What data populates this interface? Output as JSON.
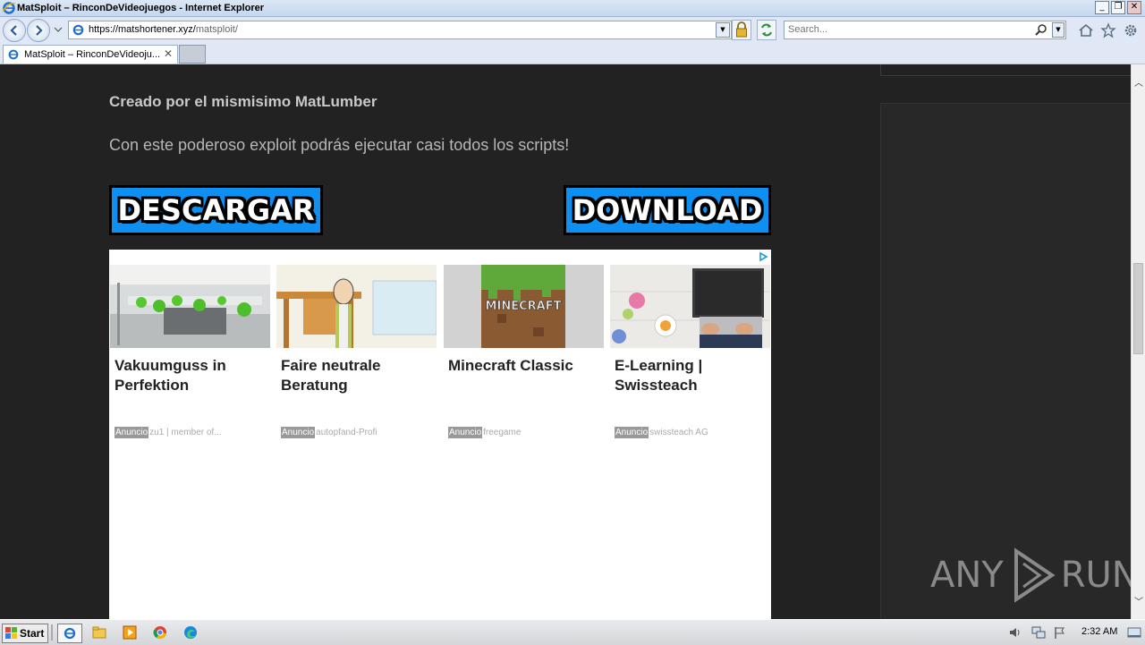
{
  "window": {
    "title": "MatSploit – RinconDeVideojuegos - Internet Explorer",
    "minimize": "_",
    "restore": "❐",
    "close": "✕"
  },
  "address": {
    "url_host": "https://matshortener.xyz/",
    "url_path": "matsploit/"
  },
  "search": {
    "placeholder": "Search..."
  },
  "tab": {
    "label": "MatSploit – RinconDeVideoju...",
    "close": "✕"
  },
  "page": {
    "creator": "Creado por el mismisimo MatLumber",
    "description": "Con este poderoso exploit podrás ejecutar casi todos los scripts!",
    "download_es": "DESCARGAR",
    "download_en": "DOWNLOAD"
  },
  "ads": [
    {
      "title": "Vakuumguss in Perfektion",
      "badge": "Anuncio",
      "source": "zu1 | member of..."
    },
    {
      "title": "Faire neutrale Beratung",
      "badge": "Anuncio",
      "source": "autopfand-Profi"
    },
    {
      "title": "Minecraft Classic",
      "badge": "Anuncio",
      "source": "freegame",
      "thumb_text": "MINECRAFT"
    },
    {
      "title": "E-Learning | Swissteach",
      "badge": "Anuncio",
      "source": "swissteach AG"
    }
  ],
  "watermark": {
    "left": "ANY",
    "right": "RUN"
  },
  "taskbar": {
    "start": "Start",
    "clock": "2:32 AM"
  },
  "colors": {
    "download_blue": "#0e8ff2",
    "page_bg": "#222222"
  }
}
